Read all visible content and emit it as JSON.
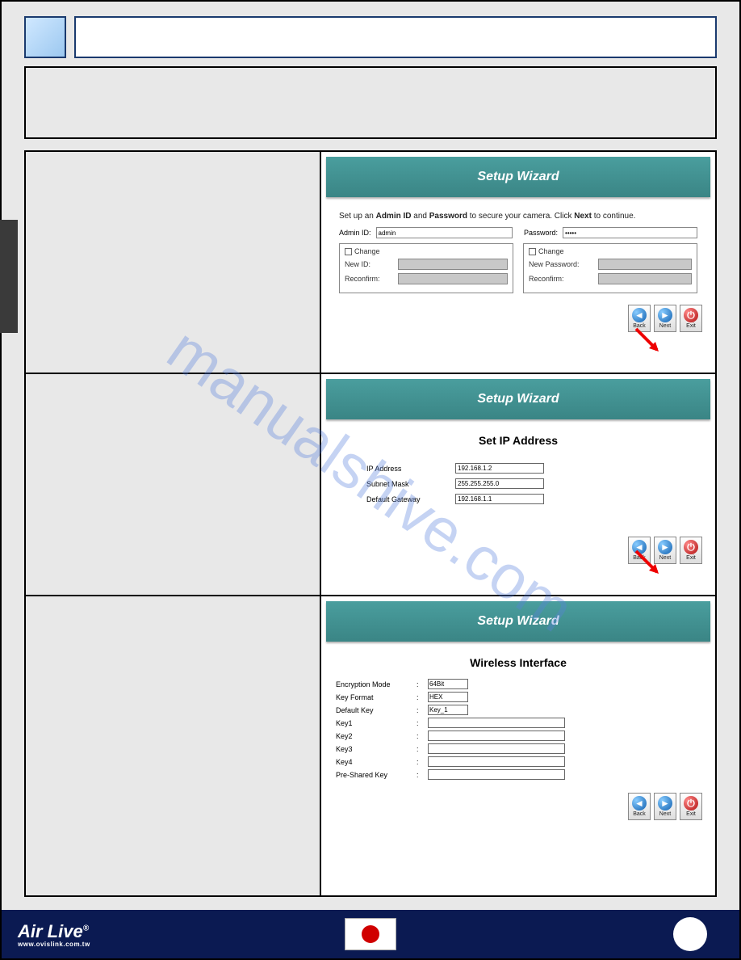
{
  "watermark": "manualshive.com",
  "wizard": {
    "title": "Setup Wizard",
    "row1": {
      "instruction_pre": "Set up an ",
      "instruction_b1": "Admin ID",
      "instruction_mid": " and ",
      "instruction_b2": "Password",
      "instruction_post": " to secure your camera. Click ",
      "instruction_b3": "Next",
      "instruction_end": " to continue.",
      "admin_id_label": "Admin ID:",
      "admin_id_value": "admin",
      "password_label": "Password:",
      "password_value": "•••••",
      "change_label": "Change",
      "new_id_label": "New ID:",
      "reconfirm_label": "Reconfirm:",
      "new_password_label": "New Password:"
    },
    "row2": {
      "subtitle": "Set IP Address",
      "ip_label": "IP Address",
      "ip_value": "192.168.1.2",
      "subnet_label": "Subnet Mask",
      "subnet_value": "255.255.255.0",
      "gateway_label": "Default Gateway",
      "gateway_value": "192.168.1.1"
    },
    "row3": {
      "subtitle": "Wireless Interface",
      "enc_label": "Encryption Mode",
      "enc_value": "64Bit",
      "keyfmt_label": "Key Format",
      "keyfmt_value": "HEX",
      "defkey_label": "Default Key",
      "defkey_value": "Key_1",
      "key1": "Key1",
      "key2": "Key2",
      "key3": "Key3",
      "key4": "Key4",
      "psk": "Pre-Shared Key"
    },
    "buttons": {
      "back": "Back",
      "next": "Next",
      "exit": "Exit"
    }
  },
  "footer": {
    "brand": "Air Live",
    "url": "www.ovislink.com.tw",
    "flag": "japan-flag"
  }
}
